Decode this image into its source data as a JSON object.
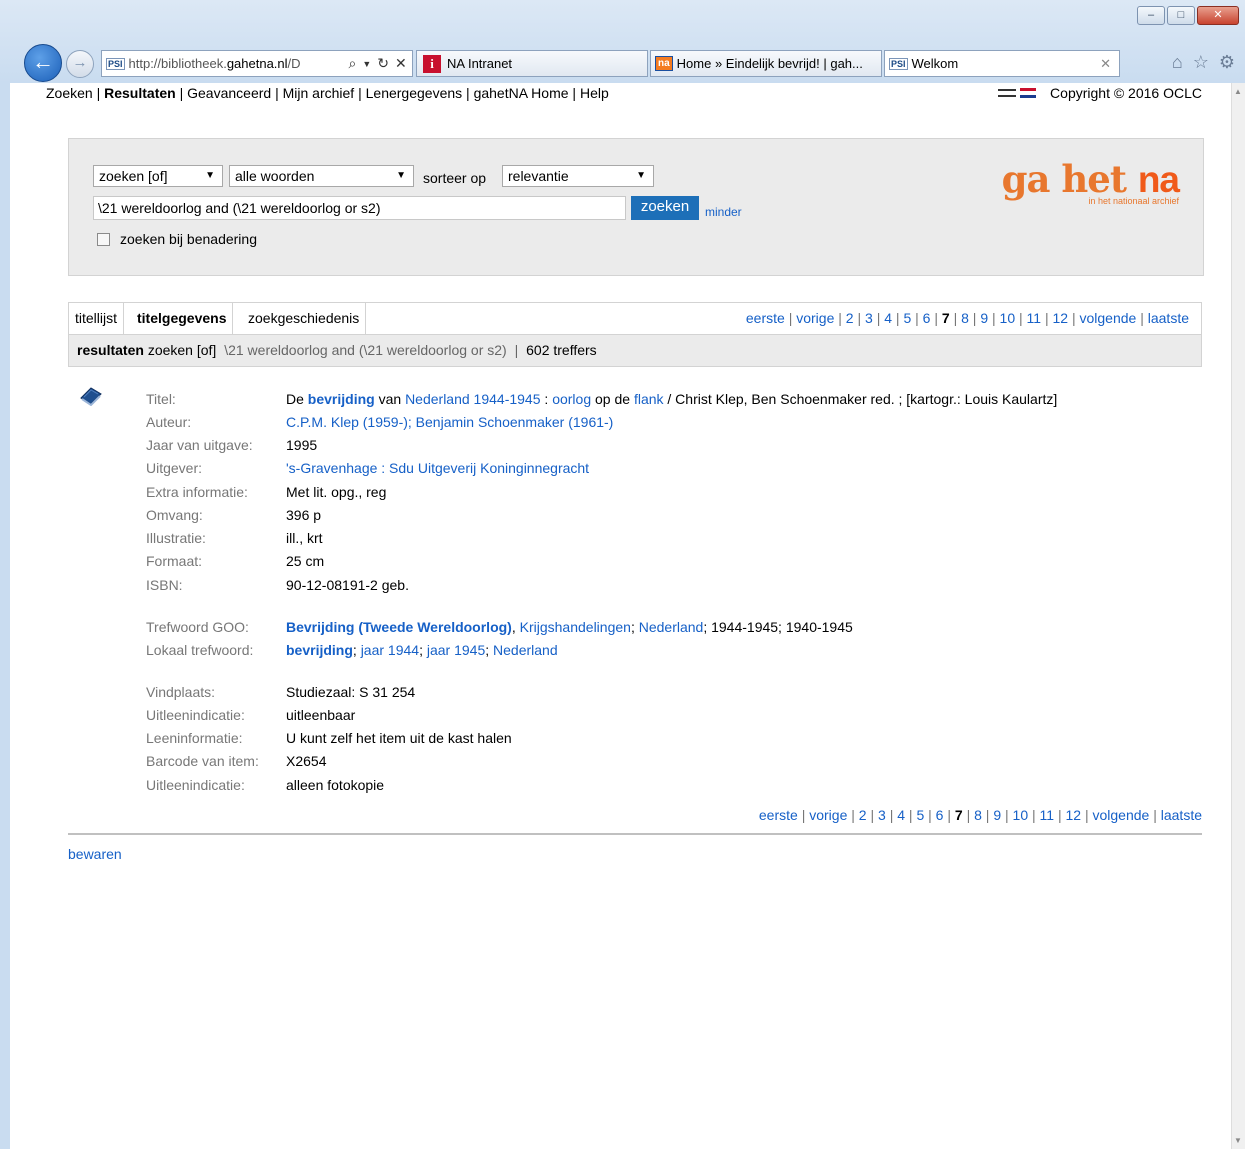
{
  "browser": {
    "address": "http://bibliotheek.gahetna.nl/D",
    "address_domain": "gahetna.nl",
    "address_prefix": "http://bibliotheek.",
    "address_suffix": "/D",
    "favicon_text": "PSI",
    "tabs": [
      {
        "label": "NA Intranet"
      },
      {
        "label": "Home » Eindelijk bevrijd! | gah..."
      },
      {
        "label": "Welkom"
      }
    ]
  },
  "topnav": {
    "items": [
      "Zoeken",
      "Resultaten",
      "Geavanceerd",
      "Mijn archief",
      "Lenergegevens",
      "gahetNA Home",
      "Help"
    ],
    "copyright": "Copyright © 2016 OCLC"
  },
  "search": {
    "mode": "zoeken [of]",
    "words": "alle woorden",
    "sort_label": "sorteer op",
    "sort": "relevantie",
    "query": "\\21 wereldoorlog and (\\21 wereldoorlog or s2)",
    "button": "zoeken",
    "minder": "minder",
    "approx_label": "zoeken bij benadering"
  },
  "logo": {
    "text1": "ga het ",
    "text2": "na",
    "sub": "in het nationaal archief"
  },
  "result_tabs": [
    "titellijst",
    "titelgegevens",
    "zoekgeschiedenis"
  ],
  "pager": {
    "first": "eerste",
    "prev": "vorige",
    "pages": [
      "2",
      "3",
      "4",
      "5",
      "6",
      "7",
      "8",
      "9",
      "10",
      "11",
      "12"
    ],
    "current": "7",
    "next": "volgende",
    "last": "laatste"
  },
  "results_bar": {
    "label": "resultaten",
    "mode": "zoeken [of]",
    "query": "\\21 wereldoorlog and (\\21 wereldoorlog or s2)",
    "sep": "|",
    "count": "602 treffers"
  },
  "record": {
    "titel_label": "Titel:",
    "titel_parts": [
      "De ",
      "bevrijding",
      " van ",
      "Nederland 1944-1945",
      " : ",
      "oorlog",
      " op de ",
      "flank",
      " / Christ Klep, Ben Schoenmaker red. ; [kartogr.: Louis Kaulartz]"
    ],
    "auteur_label": "Auteur:",
    "auteur": "C.P.M. Klep (1959-); Benjamin Schoenmaker (1961-)",
    "jaar_label": "Jaar van uitgave:",
    "jaar": "1995",
    "uitgever_label": "Uitgever:",
    "uitgever": "'s-Gravenhage : Sdu Uitgeverij Koninginnegracht",
    "extra_label": "Extra informatie:",
    "extra": "Met lit. opg., reg",
    "omvang_label": "Omvang:",
    "omvang": "396 p",
    "illustratie_label": "Illustratie:",
    "illustratie": "ill., krt",
    "formaat_label": "Formaat:",
    "formaat": "25 cm",
    "isbn_label": "ISBN:",
    "isbn": "90-12-08191-2 geb.",
    "goo_label": "Trefwoord GOO:",
    "goo_parts": [
      "Bevrijding (Tweede Wereldoorlog)",
      ", ",
      "Krijgshandelingen",
      "; ",
      "Nederland",
      "; 1944-1945; 1940-1945"
    ],
    "lokaal_label": "Lokaal trefwoord:",
    "lokaal_parts": [
      "bevrijding",
      "; ",
      "jaar 1944",
      "; ",
      "jaar 1945",
      "; ",
      "Nederland"
    ],
    "vindplaats_label": "Vindplaats:",
    "vindplaats": "Studiezaal: S 31 254",
    "uitleen_label": "Uitleenindicatie:",
    "uitleen": "uitleenbaar",
    "leeninfo_label": "Leeninformatie:",
    "leeninfo": "U kunt zelf het item uit de kast halen",
    "barcode_label": "Barcode van item:",
    "barcode": "X2654",
    "uitleen2_label": "Uitleenindicatie:",
    "uitleen2": "alleen fotokopie"
  },
  "bewaren": "bewaren"
}
